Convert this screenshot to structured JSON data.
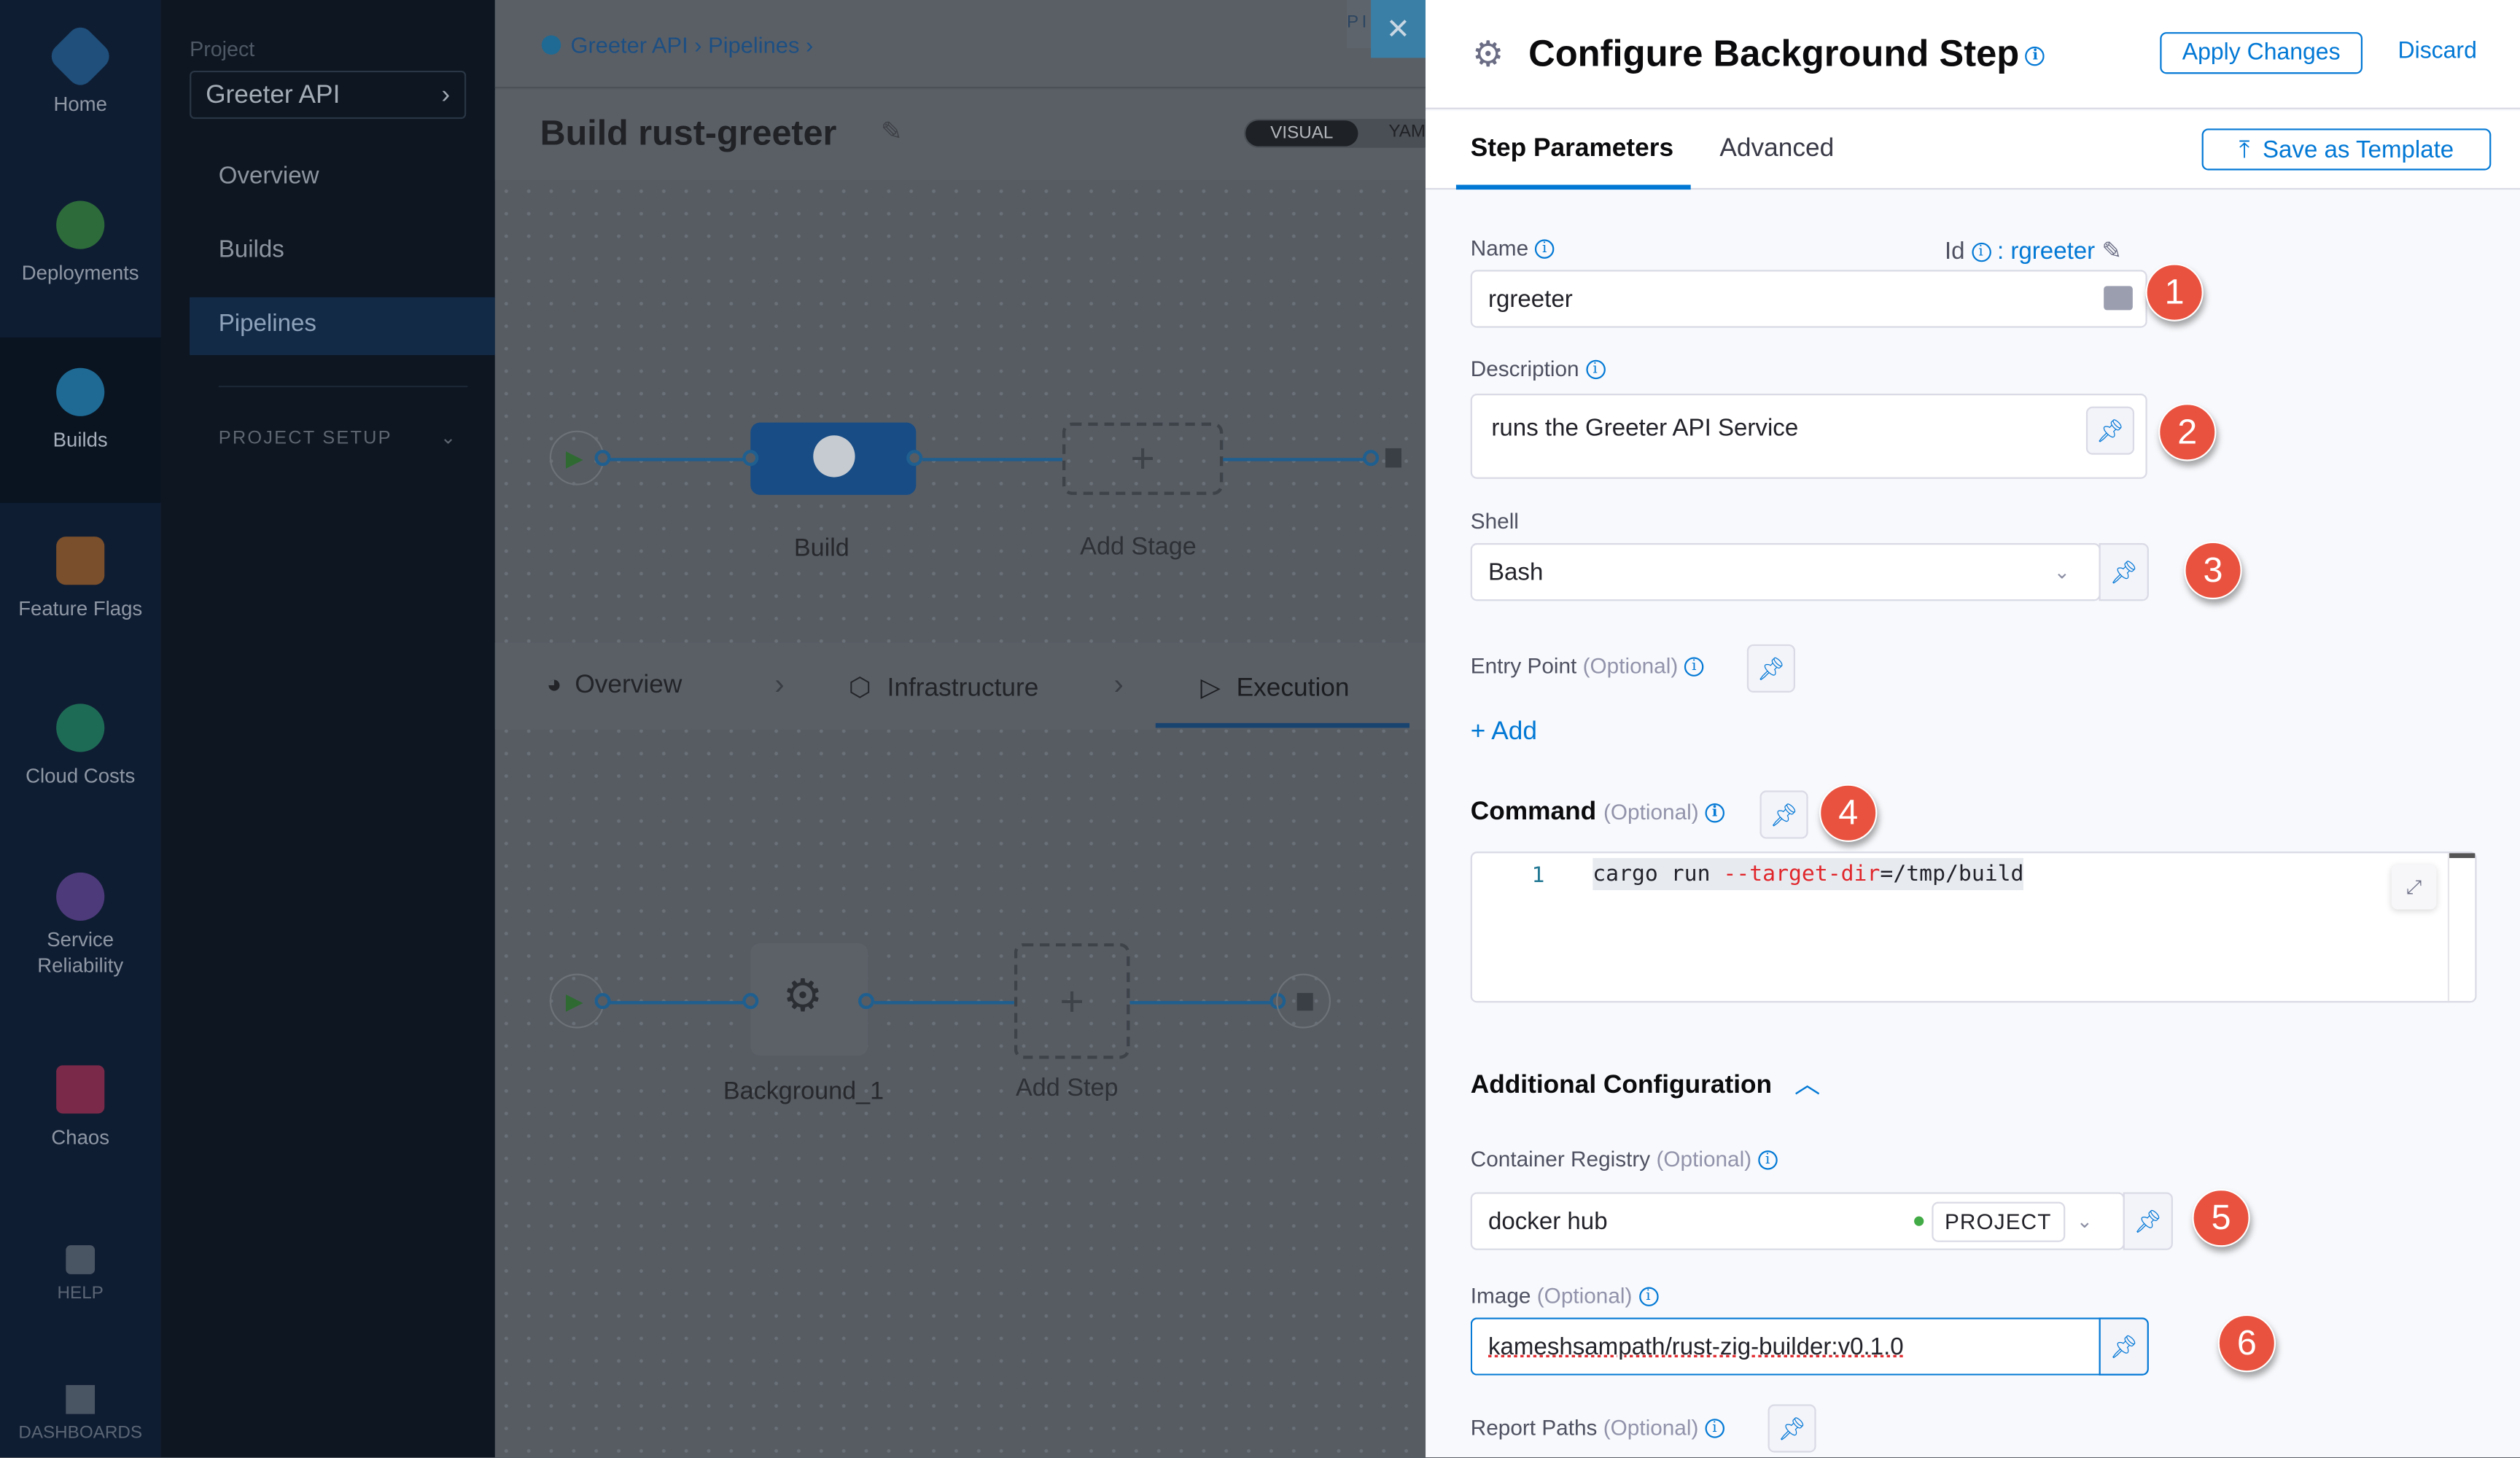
{
  "nav": {
    "items": [
      {
        "label": "Home",
        "icon": "home-icon",
        "color": "#1f4f7a"
      },
      {
        "label": "Deployments",
        "icon": "deployments-icon",
        "color": "#2d6b3a"
      },
      {
        "label": "Builds",
        "icon": "builds-icon",
        "color": "#1e6a94"
      },
      {
        "label": "Feature Flags",
        "icon": "feature-flags-icon",
        "color": "#7a4f2b"
      },
      {
        "label": "Cloud Costs",
        "icon": "cloud-costs-icon",
        "color": "#1e6b55"
      },
      {
        "label": "Service Reliability",
        "icon": "service-reliability-icon",
        "color": "#4d3a7a"
      },
      {
        "label": "Chaos",
        "icon": "chaos-icon",
        "color": "#7a2a48"
      }
    ],
    "help": "HELP",
    "dashboards": "DASHBOARDS"
  },
  "project": {
    "label": "Project",
    "name": "Greeter API",
    "items": [
      "Overview",
      "Builds",
      "Pipelines"
    ],
    "selected": "Pipelines",
    "setup": "PROJECT SETUP"
  },
  "main": {
    "breadcrumb": [
      "Greeter API",
      "Pipelines"
    ],
    "title": "Build rust-greeter",
    "view_toggle": [
      "VISUAL",
      "YAML"
    ],
    "ribbon": "PIPELINE",
    "stages": [
      {
        "label": "Build"
      },
      {
        "label": "Add Stage"
      }
    ],
    "stage_tabs": [
      "Overview",
      "Infrastructure",
      "Execution"
    ],
    "active_stage_tab": "Execution",
    "steps": [
      {
        "label": "Background_1"
      },
      {
        "label": "Add Step"
      }
    ]
  },
  "drawer": {
    "title": "Configure Background Step",
    "apply": "Apply Changes",
    "discard": "Discard",
    "tabs": [
      "Step Parameters",
      "Advanced"
    ],
    "active_tab": "Step Parameters",
    "save_template": "Save as Template",
    "name": {
      "label": "Name",
      "value": "rgreeter",
      "id_label": "Id",
      "id_value": "rgreeter"
    },
    "description": {
      "label": "Description",
      "value": "runs the Greeter API Service"
    },
    "shell": {
      "label": "Shell",
      "value": "Bash"
    },
    "entry_point": {
      "label": "Entry Point",
      "optional": "(Optional)",
      "add": "+ Add"
    },
    "command": {
      "label": "Command",
      "optional": "(Optional)",
      "line_no": "1",
      "code": [
        "cargo run ",
        "--target-dir",
        "=/tmp/build"
      ]
    },
    "additional": {
      "title": "Additional Configuration"
    },
    "registry": {
      "label": "Container Registry",
      "optional": "(Optional)",
      "value": "docker hub",
      "scope": "PROJECT",
      "status_color": "#42ab45"
    },
    "image": {
      "label": "Image",
      "optional": "(Optional)",
      "value": "kameshsampath/rust-zig-builder:v0.1.0"
    },
    "report_paths": {
      "label": "Report Paths",
      "optional": "(Optional)"
    },
    "annotations": [
      "1",
      "2",
      "3",
      "4",
      "5",
      "6"
    ]
  }
}
